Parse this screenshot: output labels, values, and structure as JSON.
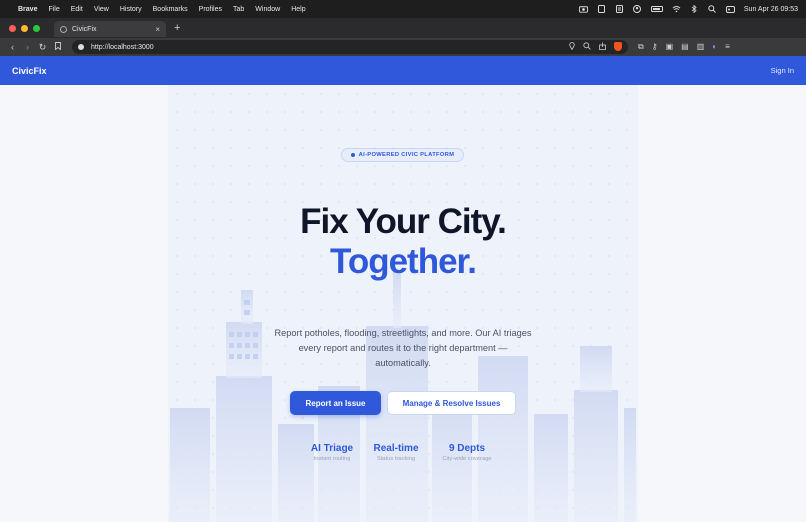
{
  "menubar": {
    "app": "Brave",
    "items": [
      "File",
      "Edit",
      "View",
      "History",
      "Bookmarks",
      "Profiles",
      "Tab",
      "Window",
      "Help"
    ],
    "clock": "Sun Apr 26  09:53"
  },
  "browser": {
    "tab_title": "CivicFix",
    "new_tab": "+",
    "tab_close": "×",
    "url": "http://localhost:3000"
  },
  "site": {
    "brand": "CivicFix",
    "signin": "Sign In",
    "badge": "AI-POWERED CIVIC PLATFORM",
    "title_line1": "Fix Your City.",
    "title_line2": "Together.",
    "subtitle": "Report potholes, flooding, streetlights, and more. Our AI triages every report and routes it to the right department — automatically.",
    "cta_primary": "Report an Issue",
    "cta_secondary": "Manage & Resolve Issues",
    "stats": [
      {
        "label": "AI Triage",
        "sub": "Instant routing"
      },
      {
        "label": "Real-time",
        "sub": "Status tracking"
      },
      {
        "label": "9 Depts",
        "sub": "City-wide coverage"
      }
    ]
  },
  "colors": {
    "accent": "#2f58db",
    "heading": "#0f1629",
    "page_bg": "#f5f7fb"
  }
}
